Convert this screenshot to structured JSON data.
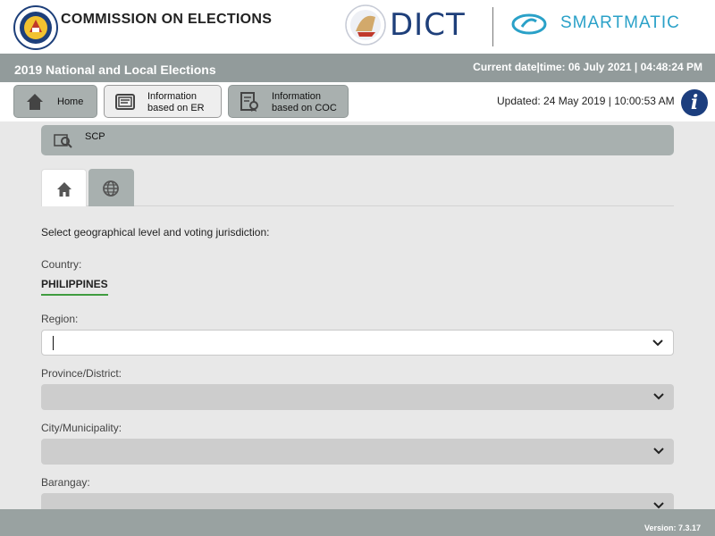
{
  "header": {
    "org_title": "COMMISSION ON ELECTIONS",
    "dict_logo_text": "DICT",
    "partner_logo_text": "SMARTMATIC"
  },
  "titlebar": {
    "election_title": "2019 National and Local Elections",
    "current_datetime": "Current date|time: 06 July 2021 | 04:48:24 PM"
  },
  "nav": {
    "home_label": "Home",
    "er_label_line1": "Information",
    "er_label_line2": "based on ER",
    "coc_label_line1": "Information",
    "coc_label_line2": "based on COC",
    "updated_text": "Updated: 24 May 2019 | 10:00:53 AM",
    "info_glyph": "i",
    "active_tab": "er"
  },
  "scp": {
    "label": "SCP"
  },
  "tabs": [
    {
      "icon": "home-icon",
      "active": true
    },
    {
      "icon": "globe-icon",
      "active": false
    }
  ],
  "form": {
    "instruction": "Select geographical level and voting jurisdiction:",
    "country_label": "Country:",
    "country_value": "PHILIPPINES",
    "region_label": "Region:",
    "region_value": "",
    "province_label": "Province/District:",
    "province_value": "",
    "city_label": "City/Municipality:",
    "city_value": "",
    "barangay_label": "Barangay:",
    "barangay_value": ""
  },
  "footer": {
    "version": "Version: 7.3.17"
  },
  "colors": {
    "bar_gray": "#929b9b",
    "button_gray": "#a9b0af",
    "info_blue": "#1c3e7e",
    "dict_blue": "#1e3f7a",
    "smartmatic_teal": "#2aa1c8",
    "country_underline": "#3f9c3f"
  }
}
